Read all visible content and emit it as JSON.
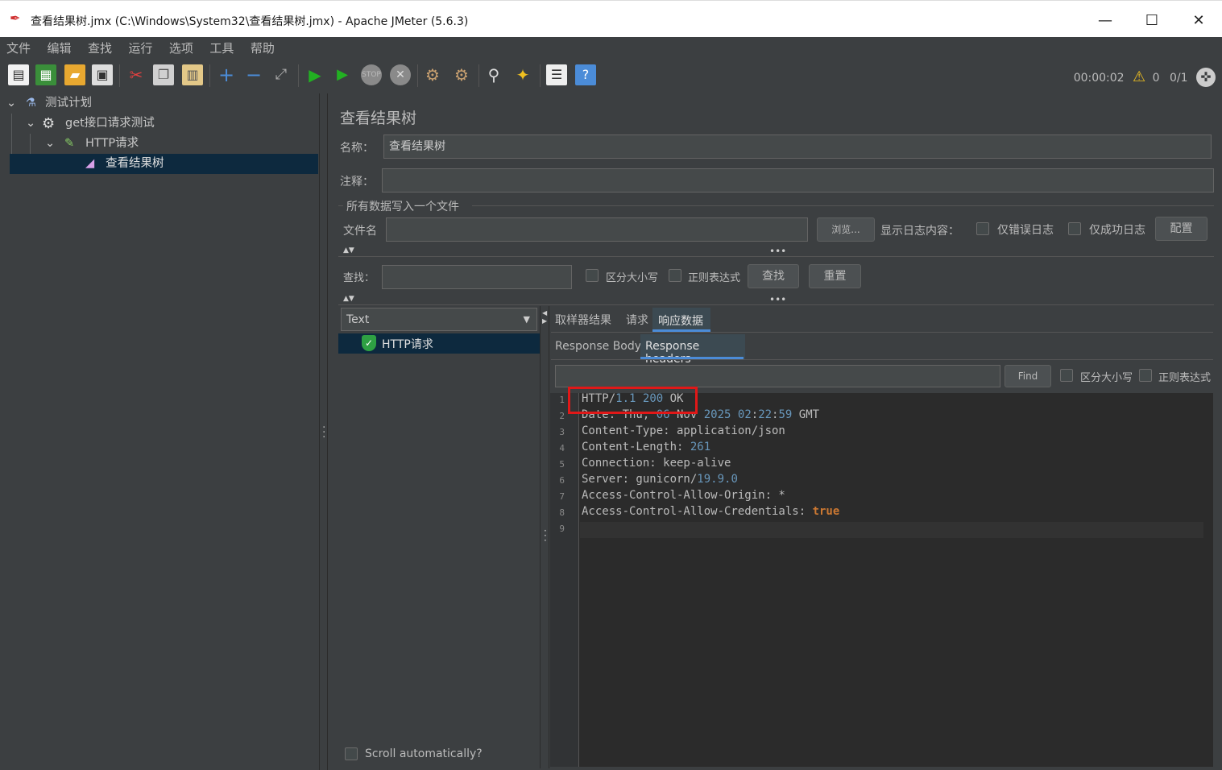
{
  "window": {
    "title": "查看结果树.jmx (C:\\Windows\\System32\\查看结果树.jmx) - Apache JMeter (5.6.3)"
  },
  "menu": [
    "文件",
    "编辑",
    "查找",
    "运行",
    "选项",
    "工具",
    "帮助"
  ],
  "toolbar": {
    "timer": "00:00:02",
    "warnings": "0",
    "threads": "0/1"
  },
  "tree": {
    "items": [
      {
        "label": "测试计划"
      },
      {
        "label": "get接口请求测试"
      },
      {
        "label": "HTTP请求"
      },
      {
        "label": "查看结果树"
      }
    ]
  },
  "panel": {
    "title": "查看结果树",
    "name_label": "名称：",
    "name_value": "查看结果树",
    "comment_label": "注释：",
    "comment_value": "",
    "file_section": "所有数据写入一个文件",
    "filename_label": "文件名",
    "filename_value": "",
    "browse_button": "浏览...",
    "log_label": "显示日志内容：",
    "errors_only": "仅错误日志",
    "success_only": "仅成功日志",
    "config_button": "配置",
    "search_label": "查找：",
    "search_value": "",
    "case_sensitive": "区分大小写",
    "regex": "正则表达式",
    "find_button": "查找",
    "reset_button": "重置"
  },
  "results": {
    "renderer": "Text",
    "items": [
      {
        "label": "HTTP请求"
      }
    ],
    "scroll_auto": "Scroll automatically?"
  },
  "tabs": {
    "top": [
      "取样器结果",
      "请求",
      "响应数据"
    ],
    "sub": [
      "Response Body",
      "Response headers"
    ],
    "find_button": "Find",
    "case_sensitive": "区分大小写",
    "regex": "正则表达式"
  },
  "response_lines": [
    "HTTP/1.1 200 OK",
    "Date: Thu, 06 Nov 2025 02:22:59 GMT",
    "Content-Type: application/json",
    "Content-Length: 261",
    "Connection: keep-alive",
    "Server: gunicorn/19.9.0",
    "Access-Control-Allow-Origin: *",
    "Access-Control-Allow-Credentials: true",
    ""
  ],
  "line_numbers": [
    "1",
    "2",
    "3",
    "4",
    "5",
    "6",
    "7",
    "8",
    "9"
  ],
  "colors": {
    "accent": "#4b8cd8",
    "highlight_box": "#e01818",
    "number": "#6897bb",
    "keyword": "#cc7832"
  }
}
